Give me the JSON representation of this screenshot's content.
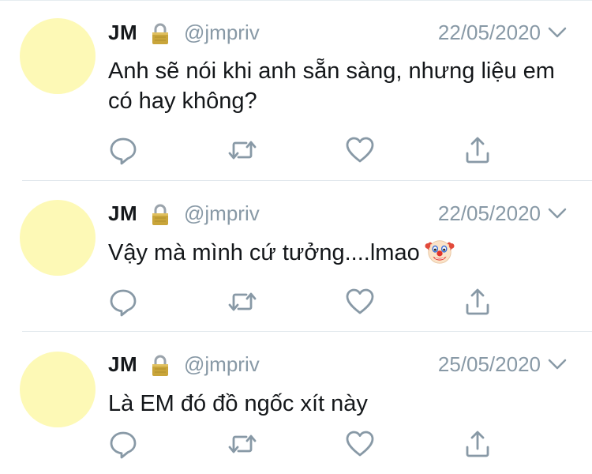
{
  "colors": {
    "avatar": "#fdf9b6",
    "name": "#14171a",
    "secondary": "#8899a6",
    "divider": "#e1e8ed",
    "icon": "#8899a6",
    "lock_body": "#c9a53a",
    "lock_shackle": "#9aa3ab"
  },
  "icons": {
    "lock": "lock-icon",
    "chevron": "chevron-down-icon",
    "reply": "reply-icon",
    "retweet": "retweet-icon",
    "like": "heart-icon",
    "share": "share-icon",
    "emoji": "clown-face-emoji"
  },
  "tweets": [
    {
      "name": "JM",
      "handle": "@jmpriv",
      "date": "22/05/2020",
      "text": "Anh sẽ nói khi anh sẵn sàng, nhưng liệu em có hay không?"
    },
    {
      "name": "JM",
      "handle": "@jmpriv",
      "date": "22/05/2020",
      "text": "Vậy mà mình cứ tưởng....lmao"
    },
    {
      "name": "JM",
      "handle": "@jmpriv",
      "date": "25/05/2020",
      "text": "Là EM đó đồ ngốc xít này"
    }
  ]
}
